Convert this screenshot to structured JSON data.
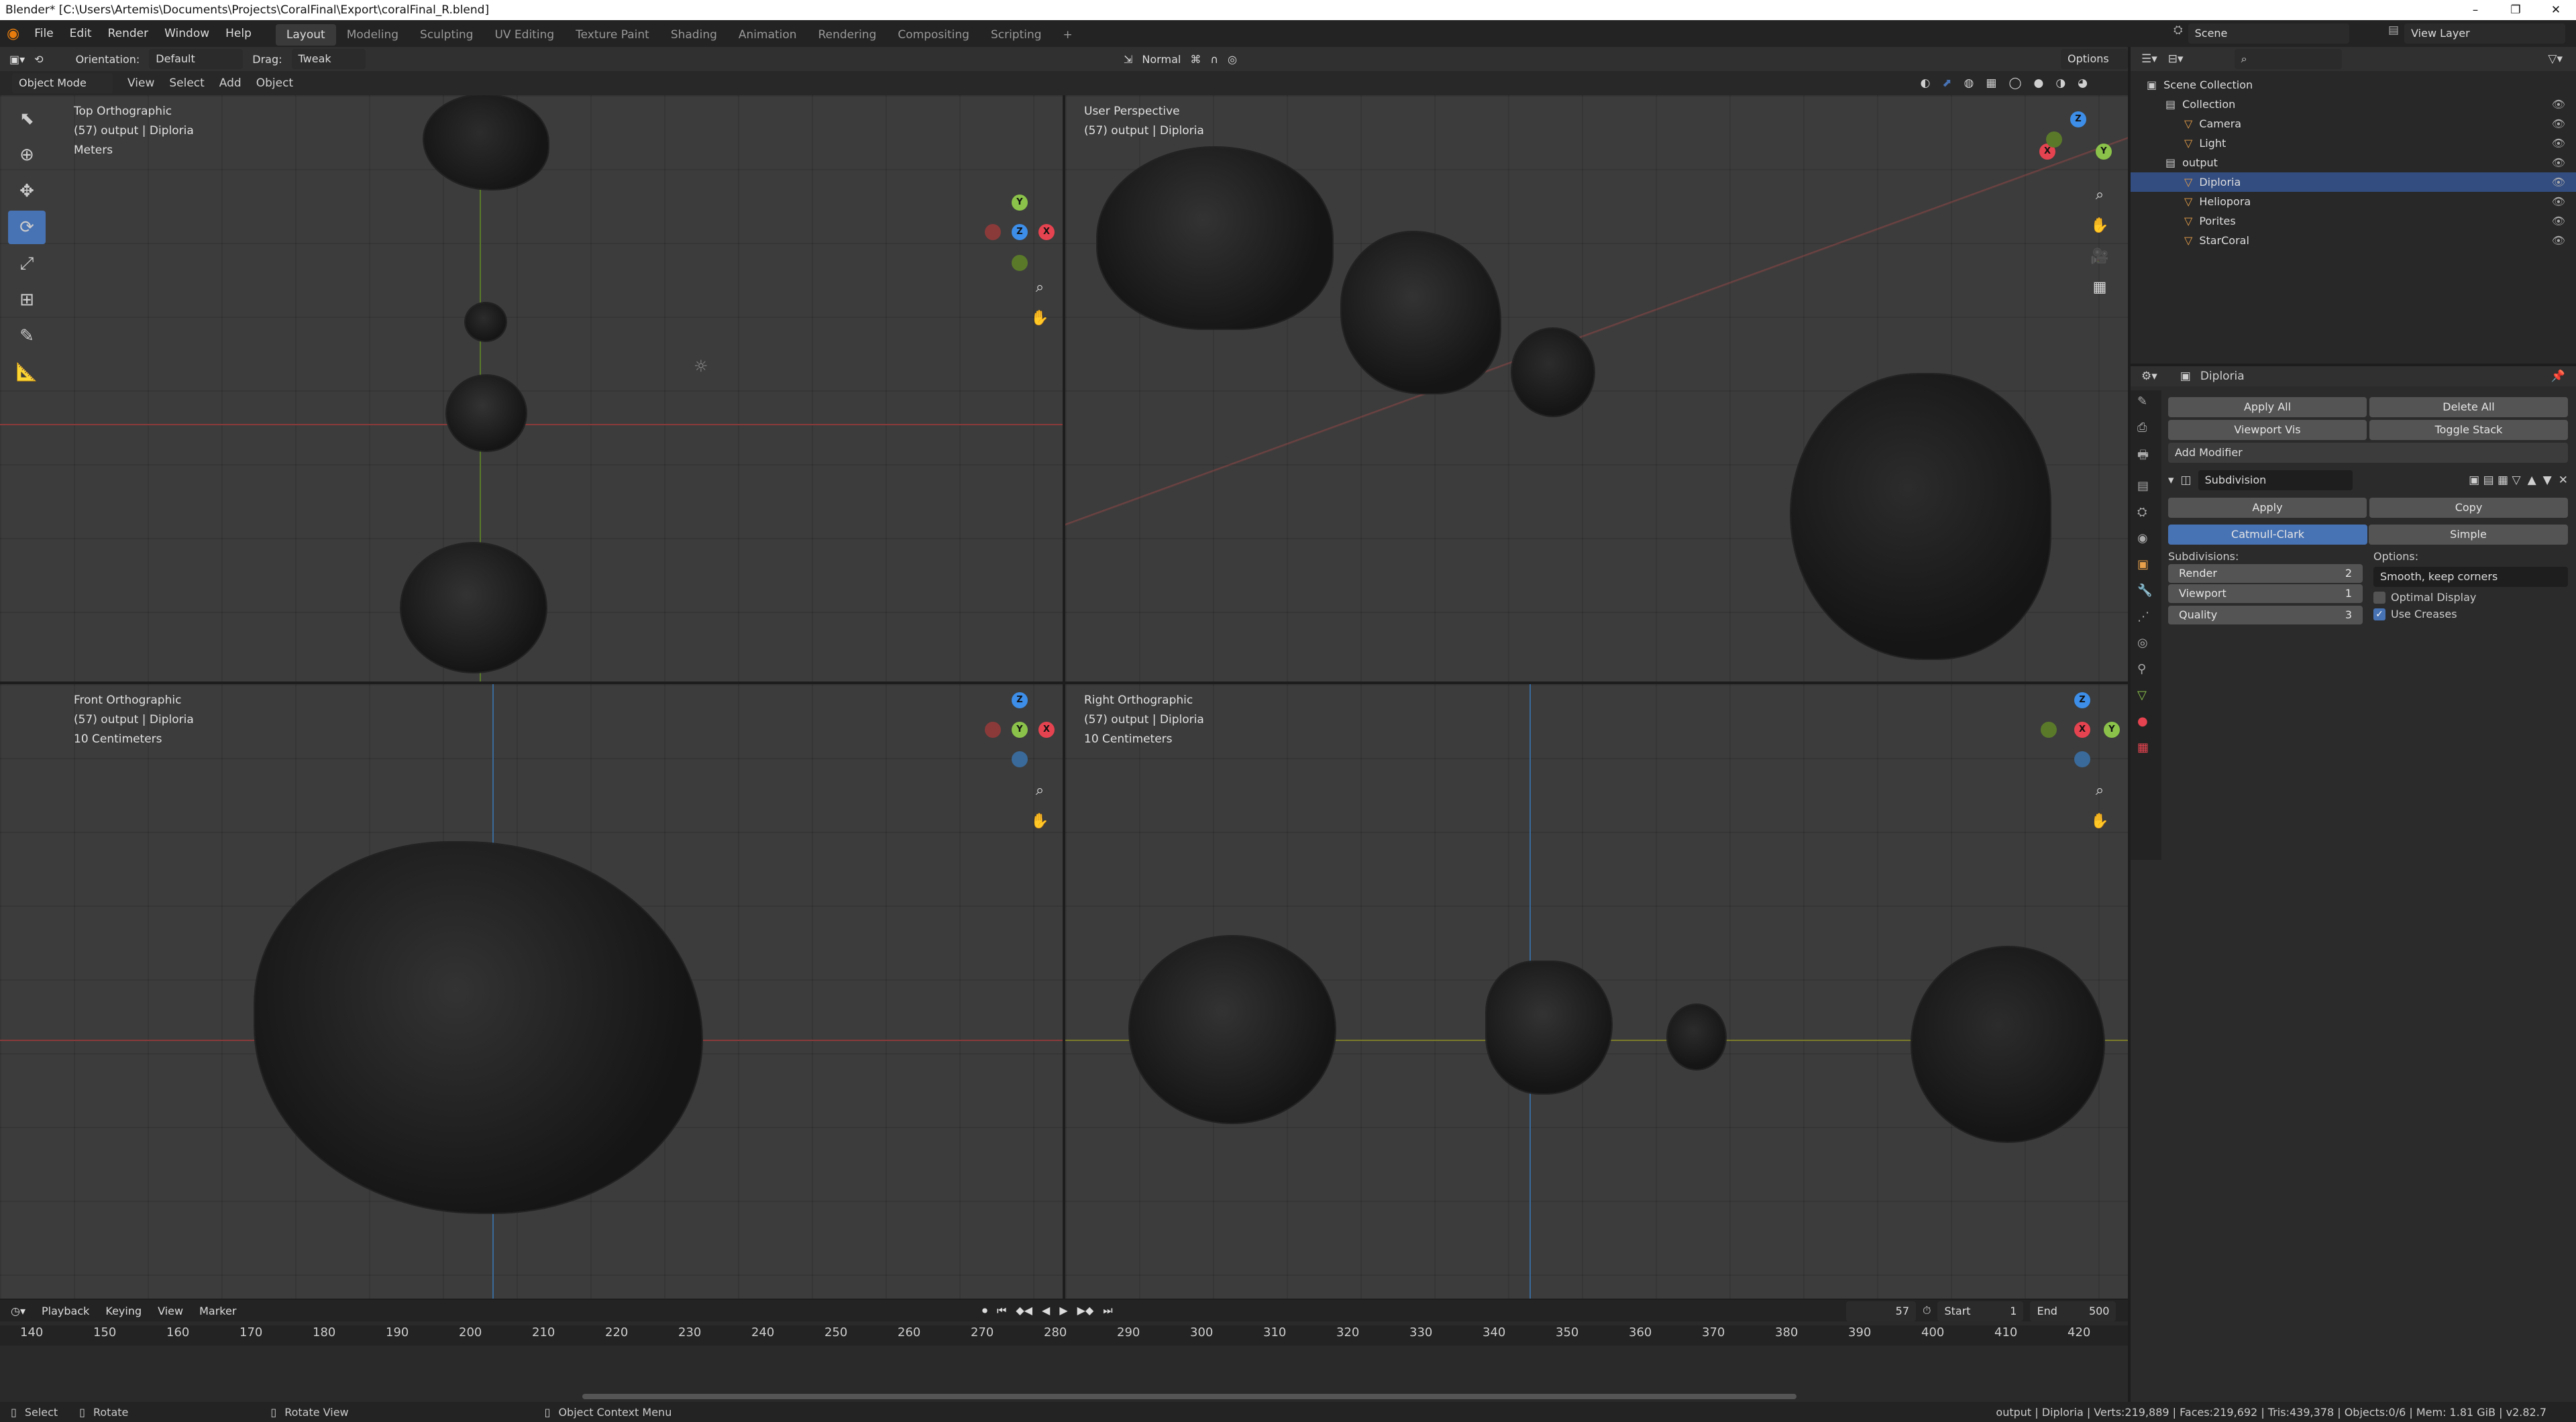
{
  "window": {
    "title": "Blender* [C:\\Users\\Artemis\\Documents\\Projects\\CoralFinal\\Export\\coralFinal_R.blend]",
    "min": "–",
    "max": "❐",
    "close": "✕"
  },
  "menu": [
    "File",
    "Edit",
    "Render",
    "Window",
    "Help"
  ],
  "workspaces": [
    "Layout",
    "Modeling",
    "Sculpting",
    "UV Editing",
    "Texture Paint",
    "Shading",
    "Animation",
    "Rendering",
    "Compositing",
    "Scripting"
  ],
  "active_workspace": "Layout",
  "plus": "+",
  "scene": {
    "label": "Scene",
    "view_layer": "View Layer"
  },
  "header3d": {
    "orientation_label": "Orientation:",
    "orientation_value": "Default",
    "drag_label": "Drag:",
    "drag_value": "Tweak",
    "pivot": "Normal",
    "options": "Options"
  },
  "header3d_row2": {
    "mode": "Object Mode",
    "view": "View",
    "select": "Select",
    "add": "Add",
    "object": "Object"
  },
  "viewports": [
    {
      "name": "Top Orthographic",
      "line2": "(57) output | Diploria",
      "line3": "Meters"
    },
    {
      "name": "User Perspective",
      "line2": "(57) output | Diploria",
      "line3": ""
    },
    {
      "name": "Front Orthographic",
      "line2": "(57) output | Diploria",
      "line3": "10 Centimeters"
    },
    {
      "name": "Right Orthographic",
      "line2": "(57) output | Diploria",
      "line3": "10 Centimeters"
    }
  ],
  "outliner": {
    "search_placeholder": "",
    "items": [
      {
        "label": "Scene Collection",
        "indent": 0
      },
      {
        "label": "Collection",
        "indent": 1
      },
      {
        "label": "Camera",
        "indent": 2
      },
      {
        "label": "Light",
        "indent": 2
      },
      {
        "label": "output",
        "indent": 1
      },
      {
        "label": "Diploria",
        "indent": 2
      },
      {
        "label": "Heliopora",
        "indent": 2
      },
      {
        "label": "Porites",
        "indent": 2
      },
      {
        "label": "StarCoral",
        "indent": 2
      }
    ]
  },
  "properties": {
    "object": "Diploria",
    "apply_all": "Apply All",
    "delete_all": "Delete All",
    "viewport_vis": "Viewport Vis",
    "toggle_stack": "Toggle Stack",
    "add_modifier": "Add Modifier",
    "modifier_name": "Subdivision",
    "apply": "Apply",
    "copy": "Copy",
    "catmull": "Catmull-Clark",
    "simple": "Simple",
    "subdivisions_label": "Subdivisions:",
    "options_label": "Options:",
    "render_label": "Render",
    "render_value": "2",
    "viewport_label": "Viewport",
    "viewport_value": "1",
    "quality_label": "Quality",
    "quality_value": "3",
    "uv_smooth": "Smooth, keep corners",
    "optimal_display": "Optimal Display",
    "optimal_display_checked": false,
    "use_creases": "Use Creases",
    "use_creases_checked": true
  },
  "timeline": {
    "playback": "Playback",
    "keying": "Keying",
    "view": "View",
    "marker": "Marker",
    "current_frame": "57",
    "start_label": "Start",
    "start_value": "1",
    "end_label": "End",
    "end_value": "500",
    "ticks": [
      "140",
      "150",
      "160",
      "170",
      "180",
      "190",
      "200",
      "210",
      "220",
      "230",
      "240",
      "250",
      "260",
      "270",
      "280",
      "290",
      "300",
      "310",
      "320",
      "330",
      "340",
      "350",
      "360",
      "370",
      "380",
      "390",
      "400",
      "410",
      "420"
    ]
  },
  "status": {
    "select": "Select",
    "rotate": "Rotate",
    "rotate_view": "Rotate View",
    "context_menu": "Object Context Menu",
    "stats": "output | Diploria | Verts:219,889 | Faces:219,692 | Tris:439,378 | Objects:0/6 | Mem: 1.81 GiB | v2.82.7"
  },
  "colors": {
    "accent": "#4772b3",
    "x_axis": "#e5434f",
    "y_axis": "#8bc34a",
    "z_axis": "#3d8ee8"
  }
}
